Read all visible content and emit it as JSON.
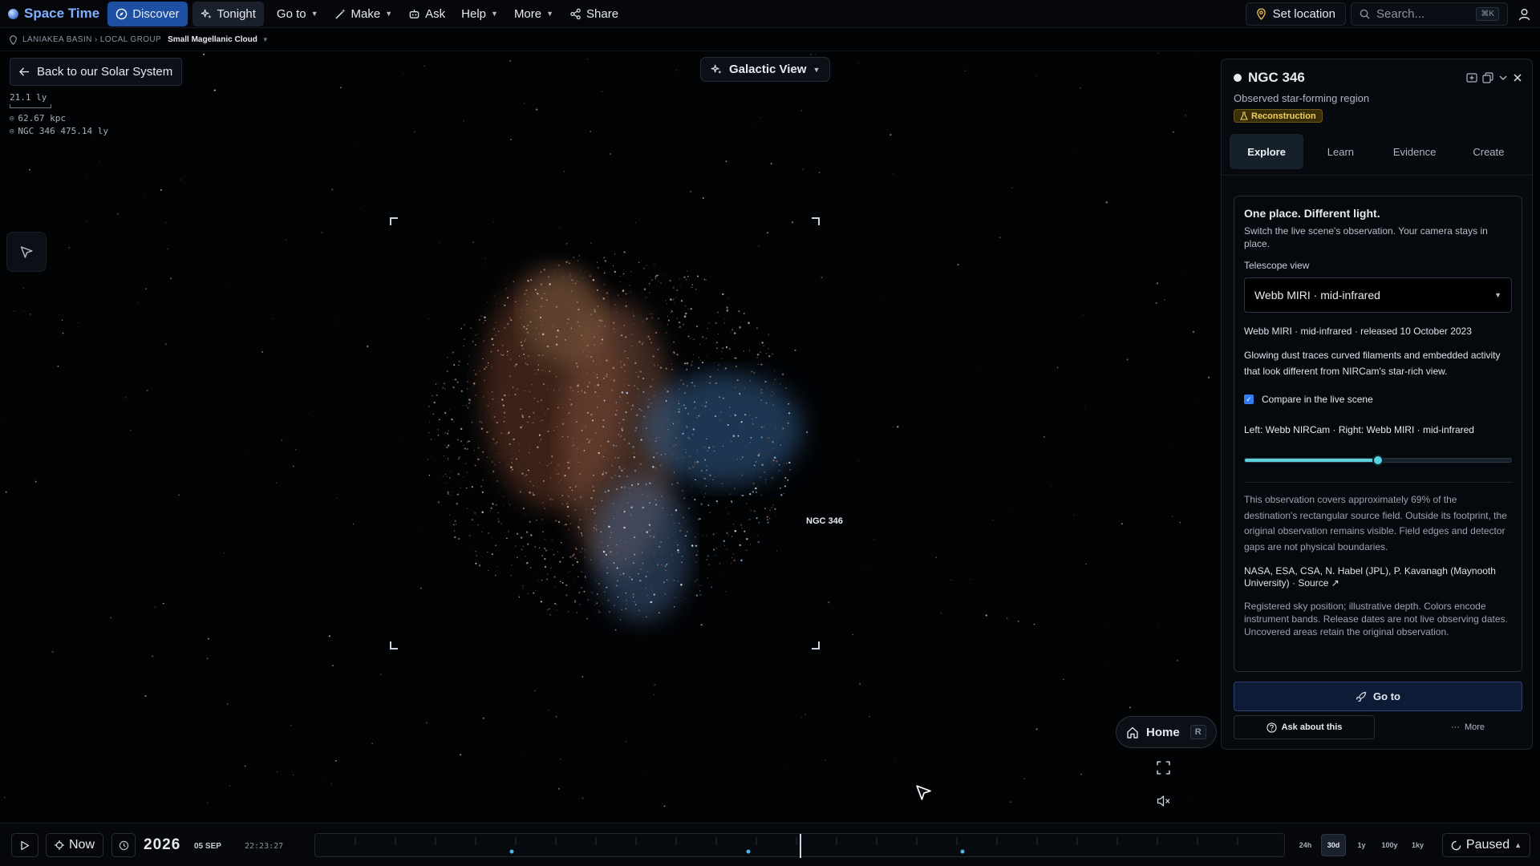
{
  "topbar": {
    "brand": "Space Time",
    "nav": [
      {
        "label": "Discover",
        "icon": "compass-icon"
      },
      {
        "label": "Tonight",
        "icon": "sparkles-icon"
      },
      {
        "label": "Go to",
        "icon": ""
      },
      {
        "label": "Make",
        "icon": "wand-icon"
      },
      {
        "label": "Ask",
        "icon": "bot-icon"
      },
      {
        "label": "Help",
        "icon": ""
      },
      {
        "label": "More",
        "icon": ""
      },
      {
        "label": "Share",
        "icon": "share-icon"
      }
    ],
    "set_location": "Set location",
    "search_placeholder": "Search...",
    "search_shortcut": "⌘K"
  },
  "breadcrumb": {
    "path": "LANIAKEA BASIN › LOCAL GROUP",
    "current": "Small Magellanic Cloud"
  },
  "viewport": {
    "back_button": "Back to our Solar System",
    "scale_label": "21.1 ly",
    "distance_1": "62.67 kpc",
    "distance_2": "NGC 346 475.14 ly",
    "view_mode": "Galactic View",
    "object_label": "NGC 346",
    "home_label": "Home",
    "home_key": "R"
  },
  "panel": {
    "title": "NGC 346",
    "subtitle": "Observed star-forming region",
    "badge": "Reconstruction",
    "tabs": [
      "Explore",
      "Learn",
      "Evidence",
      "Create"
    ],
    "active_tab": "Explore",
    "card_title": "One place. Different light.",
    "card_desc": "Switch the live scene's observation. Your camera stays in place.",
    "telescope_label": "Telescope view",
    "telescope_selected": "Webb MIRI · mid-infrared",
    "release_line": "Webb MIRI · mid-infrared · released 10 October 2023",
    "description": "Glowing dust traces curved filaments and embedded activity that look different from NIRCam's star-rich view.",
    "compare_checked": true,
    "compare_label": "Compare in the live scene",
    "split_label": "Left: Webb NIRCam · Right: Webb MIRI · mid-infrared",
    "slider_value": 0.5,
    "coverage_note": "This observation covers approximately 69% of the destination's rectangular source field. Outside its footprint, the original observation remains visible. Field edges and detector gaps are not physical boundaries.",
    "credit": "NASA, ESA, CSA, N. Habel (JPL), P. Kavanagh (Maynooth University) · ",
    "source_link": "Source ↗",
    "disclaimer": "Registered sky position; illustrative depth. Colors encode instrument bands. Release dates are not live observing dates. Uncovered areas retain the original observation.",
    "goto_button": "Go to",
    "ask_button": "Ask about this",
    "more_button": "More"
  },
  "timeline": {
    "now_label": "Now",
    "year": "2026",
    "day_month": "05 SEP",
    "time": "22:23:27",
    "ranges": [
      "24h",
      "30d",
      "1y",
      "100y",
      "1ky"
    ],
    "active_range": "30d",
    "state": "Paused"
  }
}
